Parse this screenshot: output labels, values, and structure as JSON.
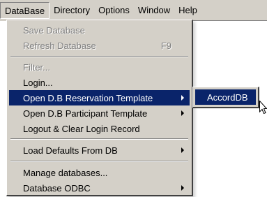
{
  "menubar": {
    "items": [
      {
        "label": "DataBase"
      },
      {
        "label": "Directory"
      },
      {
        "label": "Options"
      },
      {
        "label": "Window"
      },
      {
        "label": "Help"
      }
    ]
  },
  "database_menu": {
    "items": [
      {
        "label": "Save Database",
        "enabled": false
      },
      {
        "label": "Refresh Database",
        "shortcut": "F9",
        "enabled": false
      },
      {
        "label": "Filter...",
        "enabled": false
      },
      {
        "label": "Login...",
        "enabled": true
      },
      {
        "label": "Open D.B Reservation Template",
        "enabled": true,
        "submenu": true,
        "selected": true
      },
      {
        "label": "Open D.B Participant Template",
        "enabled": true,
        "submenu": true
      },
      {
        "label": "Logout & Clear Login Record",
        "enabled": true
      },
      {
        "label": "Load Defaults From DB",
        "enabled": true,
        "submenu": true
      },
      {
        "label": "Manage databases...",
        "enabled": true
      },
      {
        "label": "Database ODBC",
        "enabled": true,
        "submenu": true
      }
    ]
  },
  "reservation_submenu": {
    "items": [
      {
        "label": "AccordDB",
        "selected": true
      }
    ]
  },
  "colors": {
    "menu_bg": "#d4d0c8",
    "highlight": "#0a246a",
    "disabled_text": "#808080"
  },
  "icons": [
    "submenu-arrow-icon",
    "mouse-cursor-icon"
  ]
}
